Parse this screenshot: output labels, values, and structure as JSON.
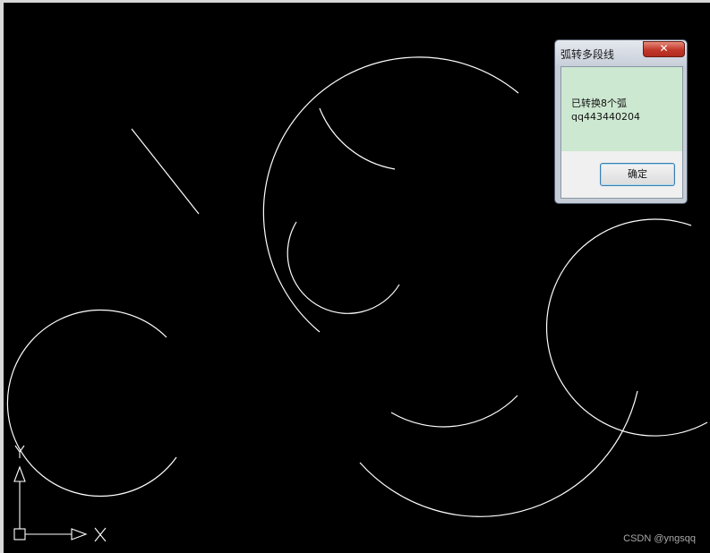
{
  "dialog": {
    "title": "弧转多段线",
    "close_glyph": "✕",
    "message_line1": "已转换8个弧",
    "message_line2": "qq443440204",
    "ok_label": "确定"
  },
  "ucs_icon": {
    "x_label": "X",
    "y_label": "Y"
  },
  "watermark": "CSDN @yngsqq",
  "colors": {
    "background": "#000000",
    "linework": "#ffffff",
    "message_bg": "#cde8d1",
    "close_button": "#c2382a"
  },
  "icons": [
    "close-icon",
    "ucs-axis-icon"
  ]
}
